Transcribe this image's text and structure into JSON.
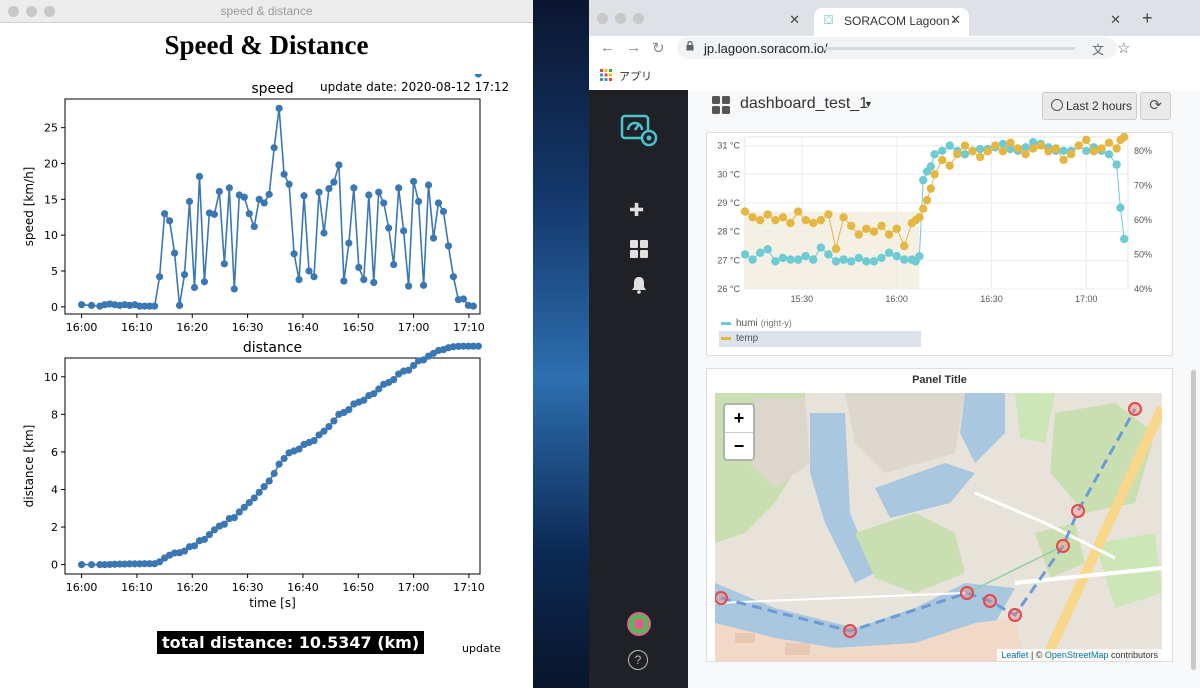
{
  "left_window": {
    "title": "speed & distance",
    "figure_title": "Speed & Distance",
    "update_date": "update date: 2020-08-12 17:12",
    "total_distance": "total distance: 10.5347 (km)",
    "update_button": "update"
  },
  "chart_data": [
    {
      "type": "line",
      "title": "speed",
      "xlabel": "",
      "ylabel": "speed [km/h]",
      "xlim": [
        0,
        75
      ],
      "ylim": [
        -1,
        29
      ],
      "x_ticks": [
        {
          "v": 3,
          "label": "16:00"
        },
        {
          "v": 13,
          "label": "16:10"
        },
        {
          "v": 23,
          "label": "16:20"
        },
        {
          "v": 33,
          "label": "16:30"
        },
        {
          "v": 43,
          "label": "16:40"
        },
        {
          "v": 53,
          "label": "16:50"
        },
        {
          "v": 63,
          "label": "17:00"
        },
        {
          "v": 73,
          "label": "17:10"
        }
      ],
      "y_ticks": [
        0,
        5,
        10,
        15,
        20,
        25
      ],
      "color": "#3b78b3",
      "x": [
        3,
        4.8,
        6.3,
        7.2,
        8.1,
        9,
        9.9,
        10.8,
        11.7,
        12.6,
        13.5,
        14.4,
        15.3,
        16.2,
        17.1,
        18,
        18.9,
        19.8,
        20.7,
        21.6,
        22.5,
        23.4,
        24.3,
        25.2,
        26.1,
        27,
        27.9,
        28.8,
        29.7,
        30.6,
        31.5,
        32.4,
        33.3,
        34.2,
        35.1,
        36,
        36.9,
        37.8,
        38.7,
        39.6,
        40.5,
        41.4,
        42.3,
        43.2,
        44.1,
        45,
        45.9,
        46.8,
        47.7,
        48.6,
        49.5,
        50.4,
        51.3,
        52.2,
        53.1,
        54,
        54.9,
        55.8,
        56.7,
        57.6,
        58.5,
        59.4,
        60.3,
        61.2,
        62.1,
        63,
        63.9,
        64.8,
        65.7,
        66.6,
        67.5,
        68.4,
        69.3,
        70.2,
        71.1,
        72,
        72.9,
        73.8,
        74.7
      ],
      "y": [
        0.3,
        0.2,
        0.1,
        0.3,
        0.4,
        0.3,
        0.2,
        0.3,
        0.2,
        0.3,
        0.1,
        0.1,
        0.1,
        0.1,
        4.2,
        13,
        12,
        7.5,
        0.2,
        4.5,
        14.7,
        2.7,
        18.2,
        3.5,
        13.1,
        12.9,
        16.1,
        6,
        16.6,
        2.5,
        15.6,
        15.3,
        13,
        11.2,
        15,
        14.5,
        15.7,
        22.2,
        27.7,
        18.5,
        17.1,
        7.4,
        3.8,
        15.5,
        5,
        4.2,
        16,
        10.3,
        16.5,
        17.4,
        19.8,
        3.6,
        8.9,
        16.6,
        5.5,
        3.8,
        15.6,
        3.4,
        16,
        14.5,
        11,
        5.9,
        16.6,
        10.6,
        2.9,
        17.5,
        14.7,
        3,
        17,
        9.6,
        14.5,
        13.3,
        8.5,
        4.2,
        1,
        1.1,
        0.2,
        0.1
      ]
    },
    {
      "type": "line",
      "title": "distance",
      "xlabel": "time [s]",
      "ylabel": "distance [km]",
      "xlim": [
        0,
        75
      ],
      "ylim": [
        -0.5,
        11
      ],
      "x_ticks": [
        {
          "v": 3,
          "label": "16:00"
        },
        {
          "v": 13,
          "label": "16:10"
        },
        {
          "v": 23,
          "label": "16:20"
        },
        {
          "v": 33,
          "label": "16:30"
        },
        {
          "v": 43,
          "label": "16:40"
        },
        {
          "v": 53,
          "label": "16:50"
        },
        {
          "v": 63,
          "label": "17:00"
        },
        {
          "v": 73,
          "label": "17:10"
        }
      ],
      "y_ticks": [
        0,
        2,
        4,
        6,
        8,
        10
      ],
      "color": "#3b78b3",
      "x": [
        3,
        4.8,
        6.3,
        7.2,
        8.1,
        9,
        9.9,
        10.8,
        11.7,
        12.6,
        13.5,
        14.4,
        15.3,
        16.2,
        17.1,
        18,
        18.9,
        19.8,
        20.7,
        21.6,
        22.5,
        23.4,
        24.3,
        25.2,
        26.1,
        27,
        27.9,
        28.8,
        29.7,
        30.6,
        31.5,
        32.4,
        33.3,
        34.2,
        35.1,
        36,
        36.9,
        37.8,
        38.7,
        39.6,
        40.5,
        41.4,
        42.3,
        43.2,
        44.1,
        45,
        45.9,
        46.8,
        47.7,
        48.6,
        49.5,
        50.4,
        51.3,
        52.2,
        53.1,
        54,
        54.9,
        55.8,
        56.7,
        57.6,
        58.5,
        59.4,
        60.3,
        61.2,
        62.1,
        63,
        63.9,
        64.8,
        65.7,
        66.6,
        67.5,
        68.4,
        69.3,
        70.2,
        71.1,
        72,
        72.9,
        73.8,
        74.7
      ],
      "y": [
        0,
        0,
        0,
        0,
        0.01,
        0.02,
        0.03,
        0.03,
        0.04,
        0.04,
        0.04,
        0.05,
        0.05,
        0.05,
        0.15,
        0.35,
        0.5,
        0.62,
        0.63,
        0.72,
        0.95,
        1,
        1.27,
        1.34,
        1.6,
        1.85,
        2.05,
        2.15,
        2.45,
        2.5,
        2.8,
        3.05,
        3.3,
        3.55,
        3.85,
        4.15,
        4.45,
        4.85,
        5.35,
        5.65,
        5.95,
        6.05,
        6.15,
        6.4,
        6.5,
        6.6,
        6.9,
        7.1,
        7.35,
        7.65,
        8,
        8.1,
        8.25,
        8.55,
        8.65,
        8.75,
        9,
        9.1,
        9.35,
        9.6,
        9.7,
        9.85,
        10.15,
        10.3,
        10.35,
        10.6,
        10.85,
        10.9,
        11.1,
        11.25,
        11.4,
        11.45,
        11.55,
        11.6,
        11.62,
        11.63,
        11.63,
        11.63,
        11.63
      ]
    },
    {
      "type": "line",
      "title": "",
      "x_ticks": [
        {
          "v": 15.5,
          "label": "15:30"
        },
        {
          "v": 16.0,
          "label": "16:00"
        },
        {
          "v": 16.5,
          "label": "16:30"
        },
        {
          "v": 17.0,
          "label": "17:00"
        }
      ],
      "xlim": [
        15.2,
        17.22
      ],
      "y_left": {
        "min": 26,
        "max": 31.3,
        "ticks": [
          {
            "v": 26,
            "label": "26 °C"
          },
          {
            "v": 27,
            "label": "27 °C"
          },
          {
            "v": 28,
            "label": "28 °C"
          },
          {
            "v": 29,
            "label": "29 °C"
          },
          {
            "v": 30,
            "label": "30 °C"
          },
          {
            "v": 31,
            "label": "31 °C"
          }
        ]
      },
      "y_right": {
        "min": 40,
        "max": 84,
        "ticks": [
          {
            "v": 40,
            "label": "40%"
          },
          {
            "v": 50,
            "label": "50%"
          },
          {
            "v": 60,
            "label": "60%"
          },
          {
            "v": 70,
            "label": "70%"
          },
          {
            "v": 80,
            "label": "80%"
          }
        ]
      },
      "series": [
        {
          "name": "humi",
          "axis": "right",
          "color": "#6ecad3",
          "x": [
            15.2,
            15.24,
            15.28,
            15.32,
            15.36,
            15.4,
            15.44,
            15.48,
            15.52,
            15.56,
            15.6,
            15.64,
            15.68,
            15.72,
            15.76,
            15.8,
            15.84,
            15.88,
            15.92,
            15.96,
            16.0,
            16.04,
            16.08,
            16.1,
            16.12,
            16.14,
            16.16,
            16.18,
            16.2,
            16.24,
            16.28,
            16.32,
            16.36,
            16.4,
            16.44,
            16.48,
            16.52,
            16.56,
            16.6,
            16.64,
            16.68,
            16.72,
            16.76,
            16.8,
            16.84,
            16.88,
            16.92,
            16.96,
            17.0,
            17.04,
            17.08,
            17.12,
            17.16,
            17.18,
            17.2
          ],
          "y": [
            50,
            48.5,
            50.5,
            51.5,
            48,
            49,
            48.5,
            48.5,
            49.5,
            48.5,
            52,
            50,
            48,
            48.5,
            48,
            49,
            48,
            48,
            49,
            50.5,
            49.5,
            48.5,
            48.5,
            48,
            49.5,
            71.5,
            74,
            75.5,
            79,
            80,
            81.5,
            80,
            79,
            80,
            80.5,
            80.5,
            81,
            82,
            80.5,
            80,
            81,
            82.5,
            82,
            81,
            80,
            80,
            80,
            81.5,
            80,
            81,
            80,
            79,
            76,
            63.5,
            54.5
          ]
        },
        {
          "name": "temp",
          "axis": "left",
          "color": "#e5b642",
          "x": [
            15.2,
            15.24,
            15.28,
            15.32,
            15.36,
            15.4,
            15.44,
            15.48,
            15.52,
            15.56,
            15.6,
            15.64,
            15.68,
            15.72,
            15.76,
            15.8,
            15.84,
            15.88,
            15.92,
            15.96,
            16.0,
            16.04,
            16.08,
            16.1,
            16.12,
            16.14,
            16.16,
            16.18,
            16.2,
            16.24,
            16.28,
            16.32,
            16.36,
            16.4,
            16.44,
            16.48,
            16.52,
            16.56,
            16.6,
            16.64,
            16.68,
            16.72,
            16.76,
            16.8,
            16.84,
            16.88,
            16.92,
            16.96,
            17.0,
            17.04,
            17.08,
            17.12,
            17.16,
            17.18,
            17.2
          ],
          "y": [
            28.7,
            28.5,
            28.4,
            28.6,
            28.4,
            28.5,
            28.3,
            28.7,
            28.4,
            28.3,
            28.4,
            28.6,
            27.4,
            28.5,
            28.2,
            27.9,
            28.1,
            28,
            28.2,
            27.9,
            28.1,
            27.5,
            28.3,
            28.4,
            28.5,
            28.8,
            29.1,
            29.5,
            30,
            30.5,
            30.3,
            30.7,
            31,
            30.8,
            30.6,
            30.8,
            31,
            30.8,
            31.1,
            30.9,
            30.7,
            30.9,
            31,
            30.8,
            30.9,
            30.5,
            30.7,
            31,
            31.2,
            30.8,
            30.9,
            31.1,
            30.9,
            31.2,
            31.3
          ]
        }
      ],
      "legend": "bottom-left"
    }
  ],
  "browser": {
    "tabs": [
      {
        "label": "",
        "close": "✕"
      },
      {
        "label": "SORACOM Lagoon - d",
        "close": "✕"
      },
      {
        "label": "",
        "close": "✕"
      }
    ],
    "new_tab": "+",
    "url": "jp.lagoon.soracom.io/",
    "bookmarks_apps": "アプリ"
  },
  "grafana": {
    "dashboard_title": "dashboard_test_1",
    "time_range": "Last 2 hours",
    "sidebar_icons": [
      "plus-icon",
      "dashboards-icon",
      "bell-icon"
    ],
    "graph_panel": {
      "legend": [
        {
          "name": "humi",
          "hint": "(right-y)"
        },
        {
          "name": "temp",
          "hint": ""
        }
      ]
    },
    "map_panel": {
      "title": "Panel Title",
      "zoom_in": "+",
      "zoom_out": "−",
      "attribution_leaflet": "Leaflet",
      "attribution_sep": " | © ",
      "attribution_osm": "OpenStreetMap",
      "attribution_rest": " contributors"
    },
    "help": "?"
  },
  "colors": {
    "speed_line": "#3b78b3",
    "humi": "#6ecad3",
    "temp": "#e5b642",
    "grafana_sidebar": "#1f2126"
  }
}
